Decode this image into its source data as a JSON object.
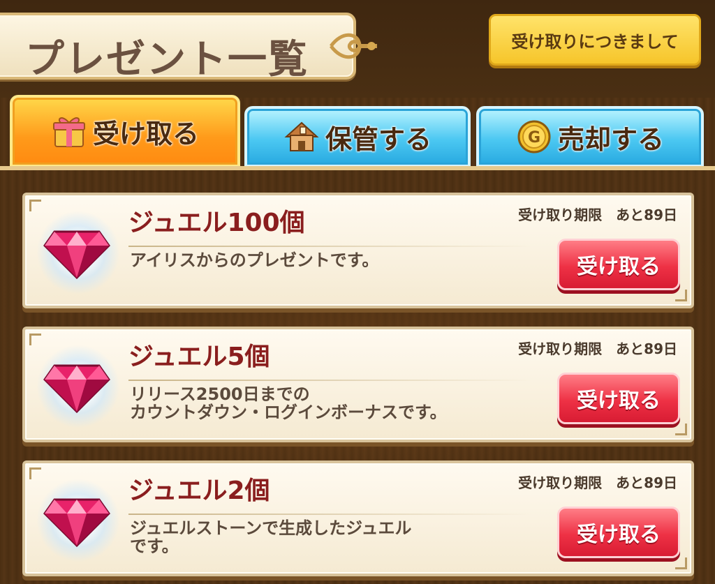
{
  "header": {
    "title": "プレゼント一覧",
    "info_button_label": "受け取りにつきまして"
  },
  "tabs": [
    {
      "label": "受け取る",
      "icon": "gift-icon",
      "active": true
    },
    {
      "label": "保管する",
      "icon": "house-icon",
      "active": false
    },
    {
      "label": "売却する",
      "icon": "gold-coin-icon",
      "active": false
    }
  ],
  "presents": [
    {
      "name": "ジュエル100個",
      "description": "アイリスからのプレゼントです。",
      "expiry": "受け取り期限　あと89日",
      "button_label": "受け取る",
      "icon": "jewel-icon"
    },
    {
      "name": "ジュエル5個",
      "description": "リリース2500日までの\nカウントダウン・ログインボーナスです。",
      "expiry": "受け取り期限　あと89日",
      "button_label": "受け取る",
      "icon": "jewel-icon"
    },
    {
      "name": "ジュエル2個",
      "description": "ジュエルストーンで生成したジュエル\nです。",
      "expiry": "受け取り期限　あと89日",
      "button_label": "受け取る",
      "icon": "jewel-icon"
    }
  ],
  "colors": {
    "active_tab": "#ff9a1a",
    "inactive_tab": "#4cc8f2",
    "receive_button": "#ee3145",
    "item_name": "#8a1e1e"
  }
}
